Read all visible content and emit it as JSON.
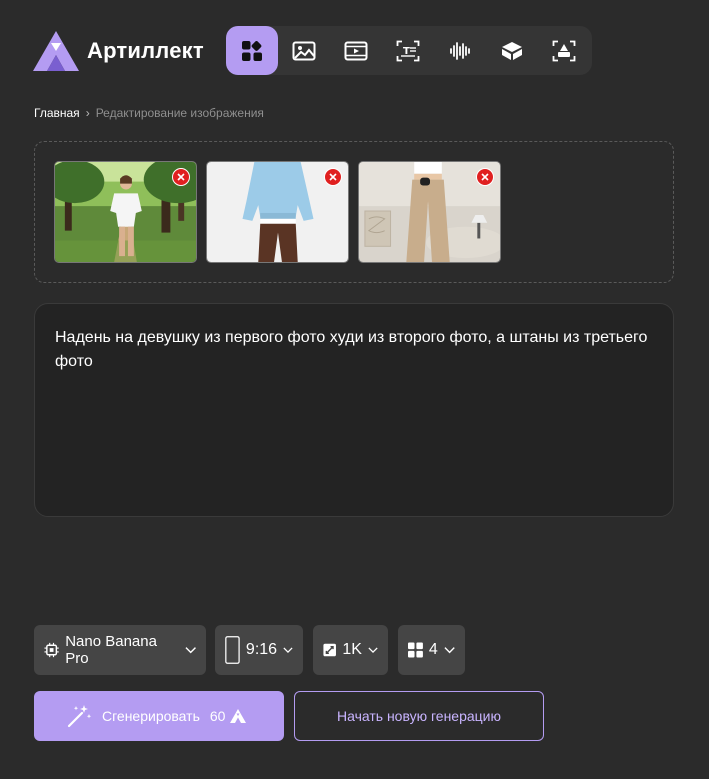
{
  "brand": {
    "name": "Артиллект",
    "accent": "#b49cf2"
  },
  "toolbar": {
    "items": [
      {
        "icon": "grid-icon",
        "active": true
      },
      {
        "icon": "image-icon",
        "active": false
      },
      {
        "icon": "video-icon",
        "active": false
      },
      {
        "icon": "text-icon",
        "active": false
      },
      {
        "icon": "audio-icon",
        "active": false
      },
      {
        "icon": "cube-icon",
        "active": false
      },
      {
        "icon": "scan-icon",
        "active": false
      }
    ]
  },
  "breadcrumb": {
    "home": "Главная",
    "separator": "›",
    "current": "Редактирование изображения"
  },
  "uploads": {
    "images": [
      {
        "subject": "girl-in-park"
      },
      {
        "subject": "blue-hoodie"
      },
      {
        "subject": "beige-pants"
      }
    ]
  },
  "prompt": {
    "text": "Надень на девушку из первого фото худи из второго фото, а штаны из третьего фото"
  },
  "settings": {
    "model": "Nano Banana Pro",
    "aspect_ratio": "9:16",
    "resolution": "1K",
    "count": "4"
  },
  "actions": {
    "generate_label": "Сгенерировать",
    "generate_cost": "60",
    "new_generation_label": "Начать новую генерацию"
  }
}
